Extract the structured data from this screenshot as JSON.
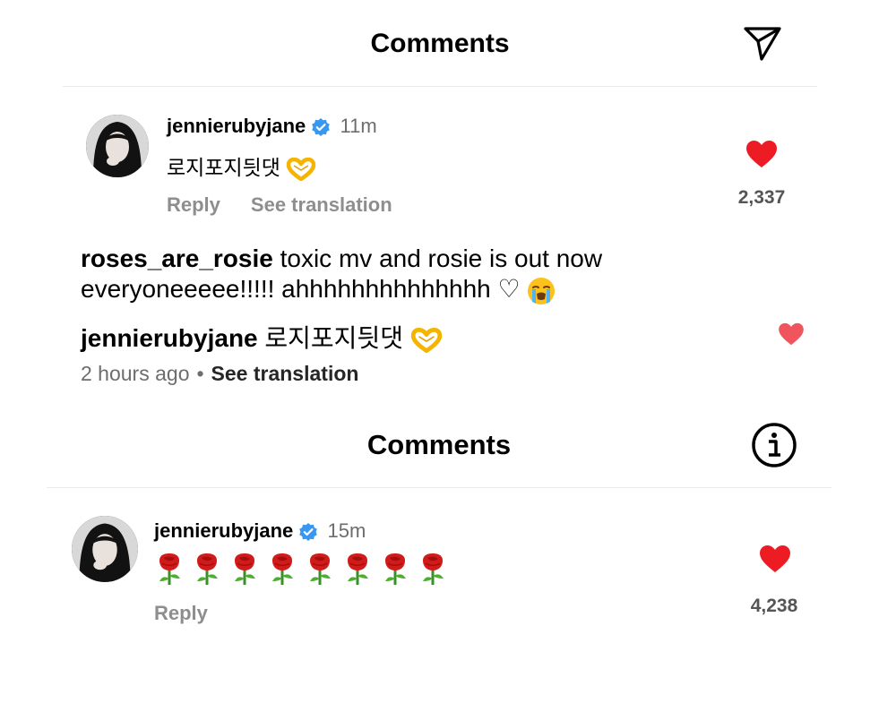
{
  "colors": {
    "like_red": "#ed1c24",
    "verified_blue": "#3897f0",
    "muted_gray": "#8e8e8e"
  },
  "panel1": {
    "title": "Comments",
    "header_icon": "send-icon",
    "comment": {
      "username": "jennierubyjane",
      "verified": true,
      "time": "11m",
      "text": "로지포지딋댓",
      "emoji": "heart-hands-emoji",
      "reply_label": "Reply",
      "translation_label": "See translation",
      "likes": "2,337"
    }
  },
  "middle": {
    "comment": {
      "username": "roses_are_rosie",
      "text": "toxic mv and rosie is out now everyoneeeee!!!!! ahhhhhhhhhhhhhh ♡",
      "emoji": "loudly-crying-face-emoji"
    },
    "reply": {
      "username": "jennierubyjane",
      "text": "로지포지딋댓",
      "emoji": "heart-hands-emoji"
    },
    "meta": {
      "time": "2 hours ago",
      "separator": "•",
      "translation_label": "See translation"
    }
  },
  "panel2": {
    "title": "Comments",
    "header_icon": "info-icon",
    "comment": {
      "username": "jennierubyjane",
      "verified": true,
      "time": "15m",
      "emoji": "rose-emoji",
      "emoji_count": 8,
      "reply_label": "Reply",
      "likes": "4,238"
    }
  }
}
